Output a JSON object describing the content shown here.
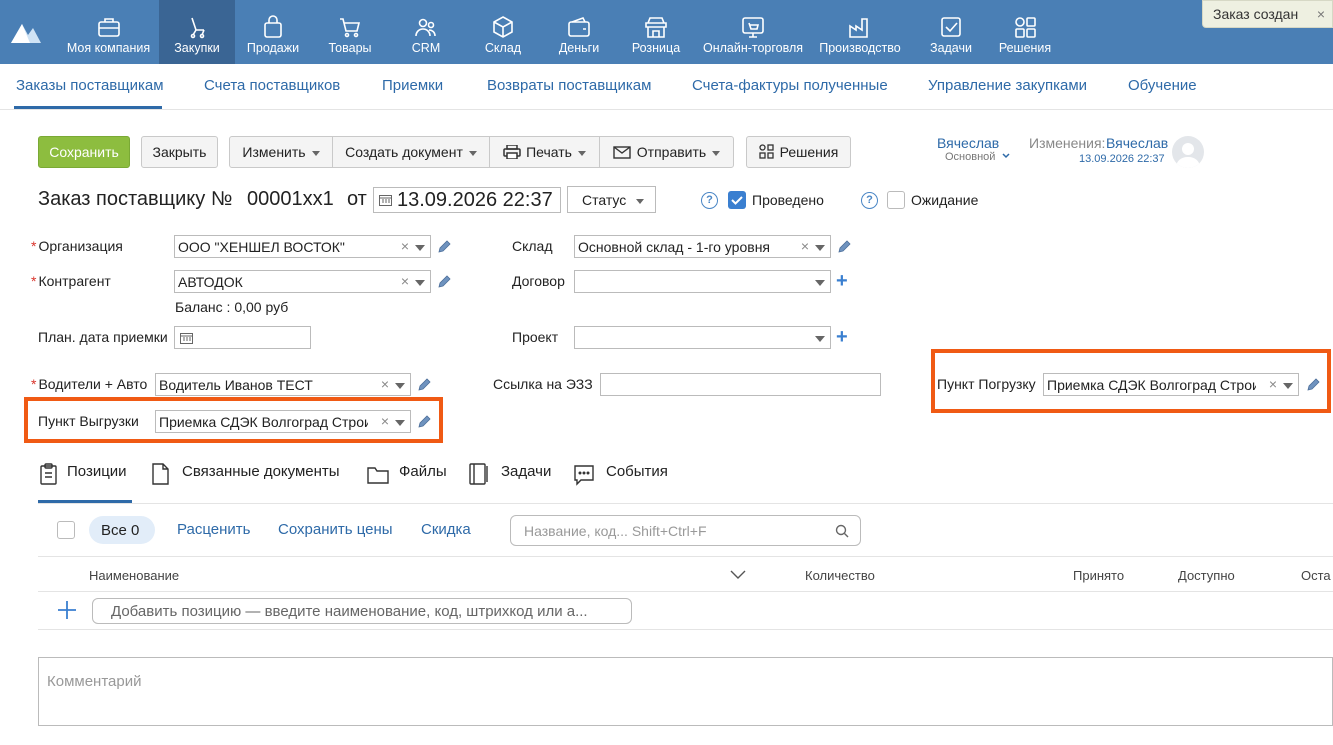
{
  "nav": {
    "items": [
      {
        "label": "Моя компания",
        "icon": "briefcase-icon"
      },
      {
        "label": "Закупки",
        "icon": "purchase-icon",
        "active": true
      },
      {
        "label": "Продажи",
        "icon": "bag-icon"
      },
      {
        "label": "Товары",
        "icon": "cart-icon"
      },
      {
        "label": "CRM",
        "icon": "people-icon"
      },
      {
        "label": "Склад",
        "icon": "box-icon"
      },
      {
        "label": "Деньги",
        "icon": "wallet-icon"
      },
      {
        "label": "Розница",
        "icon": "shop-icon"
      },
      {
        "label": "Онлайн-торговля",
        "icon": "online-shop-icon"
      },
      {
        "label": "Производство",
        "icon": "factory-icon"
      },
      {
        "label": "Задачи",
        "icon": "tasks-icon"
      },
      {
        "label": "Решения",
        "icon": "apps-icon"
      }
    ]
  },
  "toast": {
    "text": "Заказ создан",
    "close": "×"
  },
  "subnav": {
    "items": [
      "Заказы поставщикам",
      "Счета поставщиков",
      "Приемки",
      "Возвраты поставщикам",
      "Счета-фактуры полученные",
      "Управление закупками",
      "Обучение"
    ]
  },
  "toolbar": {
    "save": "Сохранить",
    "close": "Закрыть",
    "change": "Изменить",
    "create_doc": "Создать документ",
    "print": "Печать",
    "send": "Отправить",
    "solutions": "Решения"
  },
  "user": {
    "name": "Вячеслав",
    "role": "Основной",
    "changes_label": "Изменения:",
    "changes_user": "Вячеслав",
    "changes_date": "13.09.2026 22:37"
  },
  "doc": {
    "title": "Заказ поставщику №",
    "number": "00001xx1",
    "from": "от",
    "date": "13.09.2026 22:37",
    "status": "Статус",
    "posted_label": "Проведено",
    "waiting_label": "Ожидание",
    "help": "?"
  },
  "fields": {
    "org_label": "Организация",
    "org_value": "ООО \"ХЕНШЕЛ ВОСТОК\"",
    "contractor_label": "Контрагент",
    "contractor_value": "АВТОДОК",
    "balance": "Баланс : 0,00 руб",
    "plan_date_label": "План. дата приемки",
    "warehouse_label": "Склад",
    "warehouse_value": "Основной склад - 1-го уровня",
    "contract_label": "Договор",
    "project_label": "Проект",
    "drivers_label": "Водители + Авто",
    "drivers_value": "Водитель Иванов ТЕСТ",
    "ezz_label": "Ссылка на ЭЗЗ",
    "loading_label": "Пункт Погрузку",
    "loading_value": "Приемка СДЭК Волгоград Строите",
    "unloading_label": "Пункт Выгрузки",
    "unloading_value": "Приемка СДЭК Волгоград Строите",
    "required_mark": "*",
    "clear": "×"
  },
  "tabs": [
    "Позиции",
    "Связанные документы",
    "Файлы",
    "Задачи",
    "События"
  ],
  "positions": {
    "all_pill": "Все 0",
    "actions": [
      "Расценить",
      "Сохранить цены",
      "Скидка"
    ],
    "search_placeholder": "Название, код... Shift+Ctrl+F",
    "columns": [
      "Наименование",
      "Количество",
      "Принято",
      "Доступно",
      "Оста"
    ],
    "add_placeholder": "Добавить позицию — введите наименование, код, штрихкод или а..."
  },
  "comment_placeholder": "Комментарий",
  "colors": {
    "nav_bg": "#4a7fb5",
    "nav_active": "#3a6594",
    "accent": "#2e6aa8",
    "save": "#8dbd3f",
    "highlight": "#f05a14"
  }
}
